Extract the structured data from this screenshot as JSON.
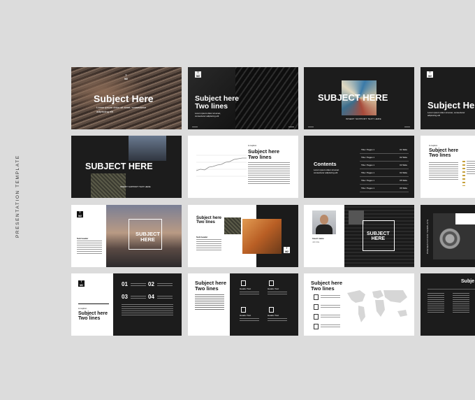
{
  "sidebar": {
    "label": "PRESENTATION TEMPLATE"
  },
  "logo": {
    "top": "T",
    "bottom": "M2"
  },
  "slides": {
    "r1c1": {
      "title": "Subject Here",
      "subtitle": "Lorem ipsum dolor sit amet, consectetur\nadipiscing elit"
    },
    "r1c2": {
      "title": "Subject here\nTwo lines",
      "subtitle": "Lorem ipsum dolor sit amet,\nconsectetur adipiscing elit"
    },
    "r1c3": {
      "title": "SUBJECT HERE",
      "subtitle": "INSERT SUPPORT TEXT HERE"
    },
    "r1c4": {
      "title": "Subject He",
      "subtitle": "Lorem ipsum dolor sit amet, consectetur\nadipiscing elit"
    },
    "r2c1": {
      "title": "SUBJECT HERE",
      "subtitle": "INSERT SUPPORT TEXT HERE"
    },
    "r2c2": {
      "title": "Subject here\nTwo lines",
      "kicker": "A caption"
    },
    "r2c3": {
      "title": "Contents",
      "subtitle": "Lorem ipsum dolor sit amet\nconsectetur adipiscing elit",
      "rows": [
        {
          "num": "01",
          "label": "Title / Pages 1",
          "page": "01 Slide"
        },
        {
          "num": "02",
          "label": "Title / Pages 1",
          "page": "02 Slide"
        },
        {
          "num": "03",
          "label": "Title / Pages 1",
          "page": "03 Slide"
        },
        {
          "num": "04",
          "label": "Title / Pages 1",
          "page": "04 Slide"
        },
        {
          "num": "05",
          "label": "Title / Pages 1",
          "page": "05 Slide"
        },
        {
          "num": "06",
          "label": "Title / Pages 1",
          "page": "06 Slide"
        }
      ]
    },
    "r2c4": {
      "title": "Subject here\nTwo lines",
      "kicker": "A caption"
    },
    "r3c1": {
      "title": "SUBJECT\nHERE",
      "caption": "Sub header"
    },
    "r3c2": {
      "title": "Subject here\nTwo lines",
      "caption": "Sub header"
    },
    "r3c3": {
      "title": "SUBJECT\nHERE",
      "name": "Insert name",
      "role": "Job title"
    },
    "r3c4": {
      "title": "PRESENTATION TEMPLATE"
    },
    "r4c1": {
      "title": "Subject here\nTwo lines",
      "kicker": "A caption",
      "nums": [
        "01",
        "02",
        "03",
        "04"
      ]
    },
    "r4c2": {
      "title": "Subject here\nTwo lines",
      "headers": [
        "Header Text",
        "Header Text",
        "Header Text",
        "Header Text"
      ]
    },
    "r4c3": {
      "title": "Subject here\nTwo lines"
    },
    "r4c4": {
      "title": "Subje"
    }
  }
}
